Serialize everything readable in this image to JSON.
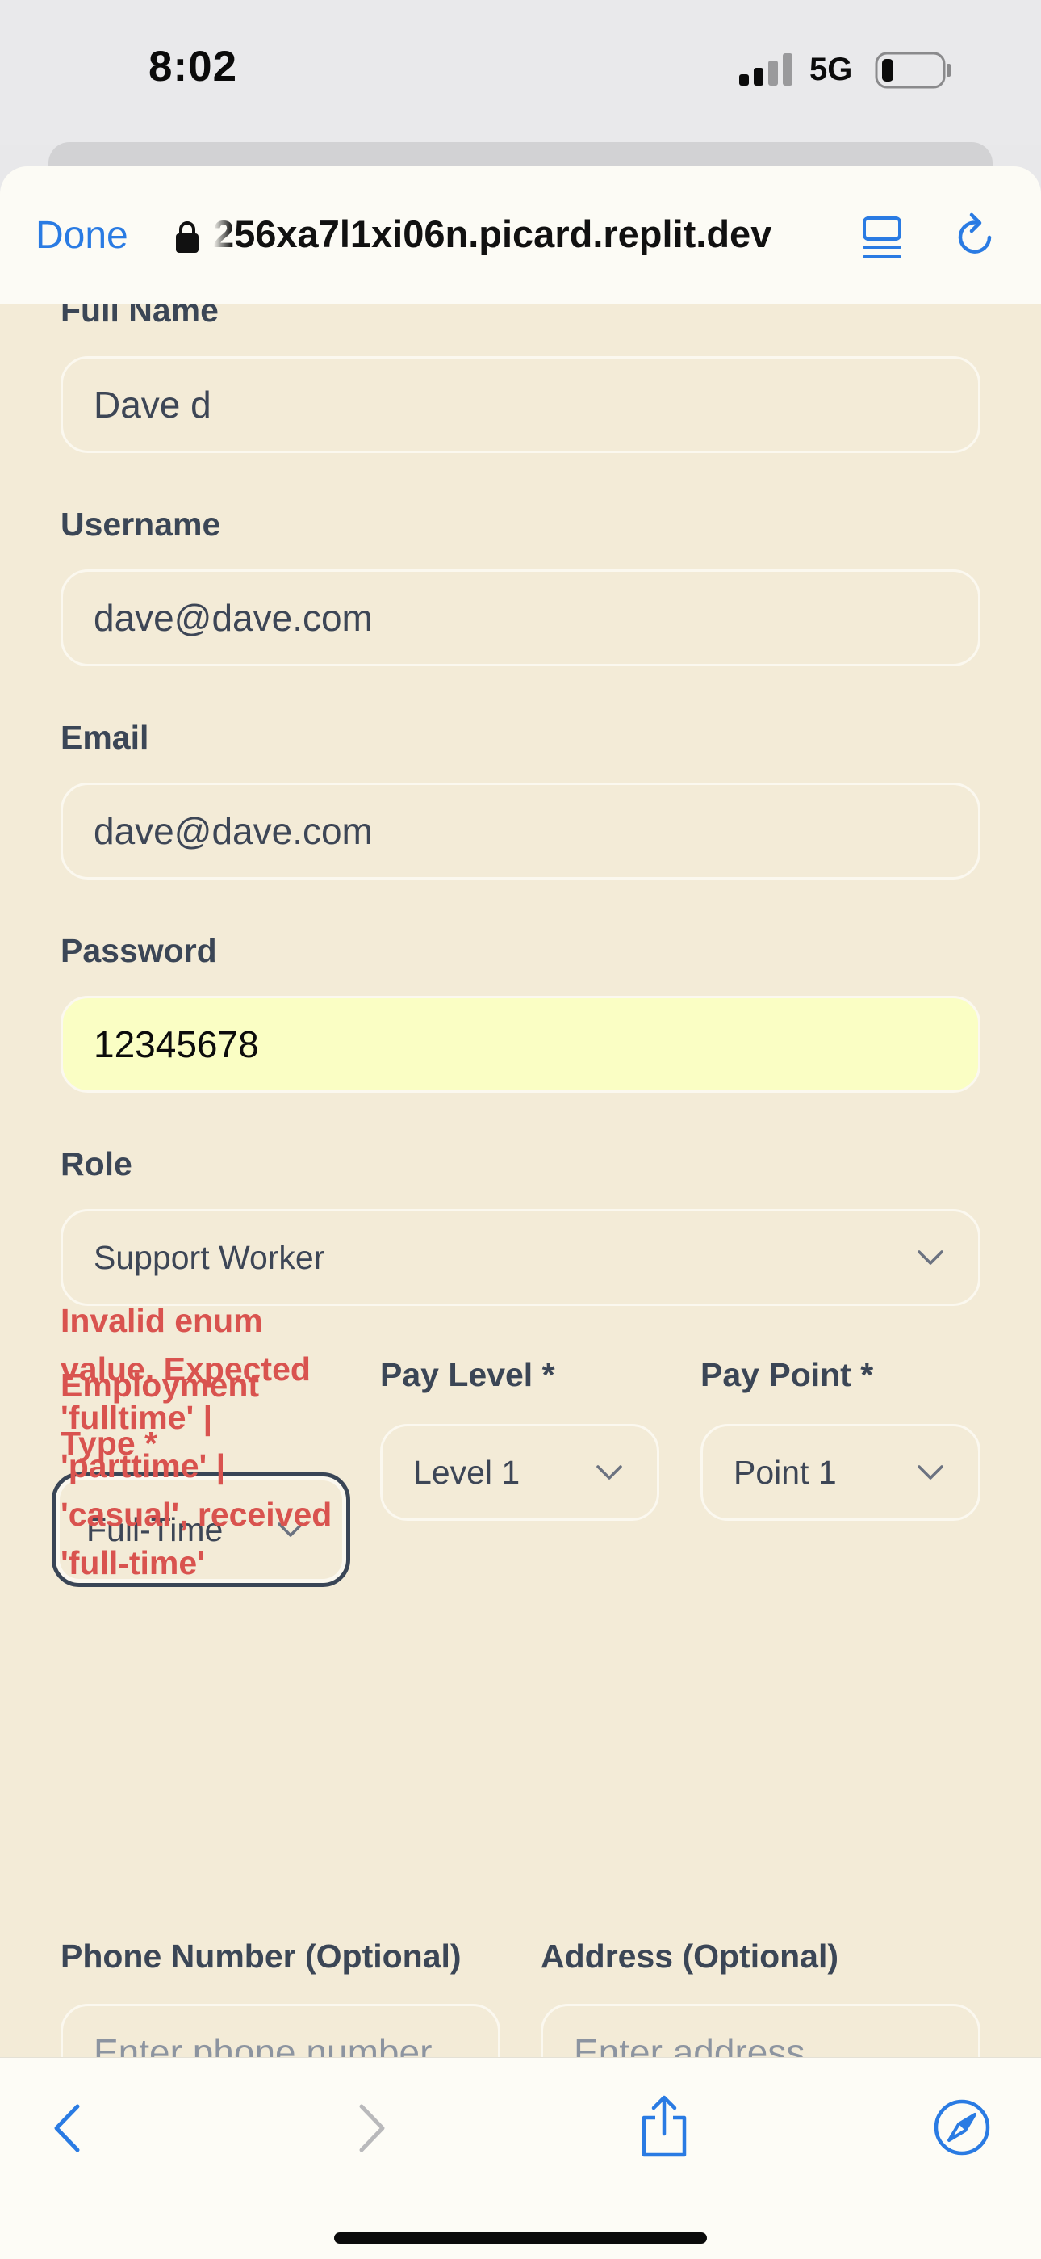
{
  "status_bar": {
    "time": "8:02",
    "network": "5G"
  },
  "browser": {
    "done_label": "Done",
    "url": "256xa7l1xi06n.picard.replit.dev",
    "accent_color": "#2a7be3"
  },
  "form": {
    "full_name": {
      "label": "Full Name",
      "value": "Dave d"
    },
    "username": {
      "label": "Username",
      "value": "dave@dave.com"
    },
    "email": {
      "label": "Email",
      "value": "dave@dave.com"
    },
    "password": {
      "label": "Password",
      "value": "12345678"
    },
    "role": {
      "label": "Role",
      "value": "Support Worker"
    },
    "employment_type": {
      "label_line1": "Employment",
      "label_line2": "Type *",
      "value": "Full-Time",
      "error_lines": [
        "Invalid enum",
        "value. Expected",
        "'fulltime' |",
        "'parttime' |",
        "'casual', received",
        "'full-time'"
      ]
    },
    "pay_level": {
      "label": "Pay Level *",
      "value": "Level 1"
    },
    "pay_point": {
      "label": "Pay Point *",
      "value": "Point 1"
    },
    "phone": {
      "label": "Phone Number (Optional)",
      "placeholder": "Enter phone number"
    },
    "address": {
      "label": "Address (Optional)",
      "placeholder": "Enter address"
    }
  },
  "colors": {
    "page_background": "#f3ebd7",
    "error": "#d9534f",
    "label": "#3b4656",
    "autofill": "#fafec4"
  },
  "icons": [
    "lock-icon",
    "reader-icon",
    "reload-icon",
    "chevron-down-icon",
    "back-icon",
    "forward-icon",
    "share-icon",
    "compass-icon"
  ]
}
